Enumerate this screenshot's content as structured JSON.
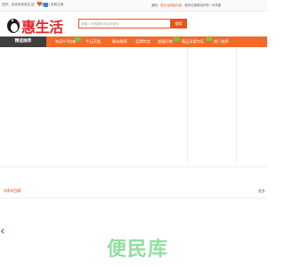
{
  "topbar": {
    "welcome": "您好，欢迎来到惠生活！ 请登录 | 免费注册",
    "notice_prefix": "通知：",
    "notice_highlight": "惠生活改版升级",
    "notice_rest": "，更多优惠精选好物一手掌握"
  },
  "logo": {
    "text": "惠生活"
  },
  "search": {
    "placeholder": "请输入你想要的商品关键字",
    "button": "搜索"
  },
  "nav": {
    "home": "精选推荐",
    "items": [
      {
        "label": "每日9.9包邮"
      },
      {
        "label": "今日天猫"
      },
      {
        "label": "精选推荐"
      },
      {
        "label": "品牌特卖"
      },
      {
        "label": "超值好物"
      },
      {
        "label": "精品母婴专区"
      },
      {
        "label": "热门推荐"
      }
    ]
  },
  "section": {
    "title": "9块9包邮",
    "more": "更多"
  },
  "watermark": "便民库",
  "colors": {
    "accent": "#f26b2a",
    "brand": "#e8252a",
    "nav_dark": "#3f3f3f",
    "tag": "#7fc341"
  },
  "icons": [
    "bird-logo-icon",
    "favorite-icon",
    "share-icon",
    "arrow-left-icon"
  ]
}
